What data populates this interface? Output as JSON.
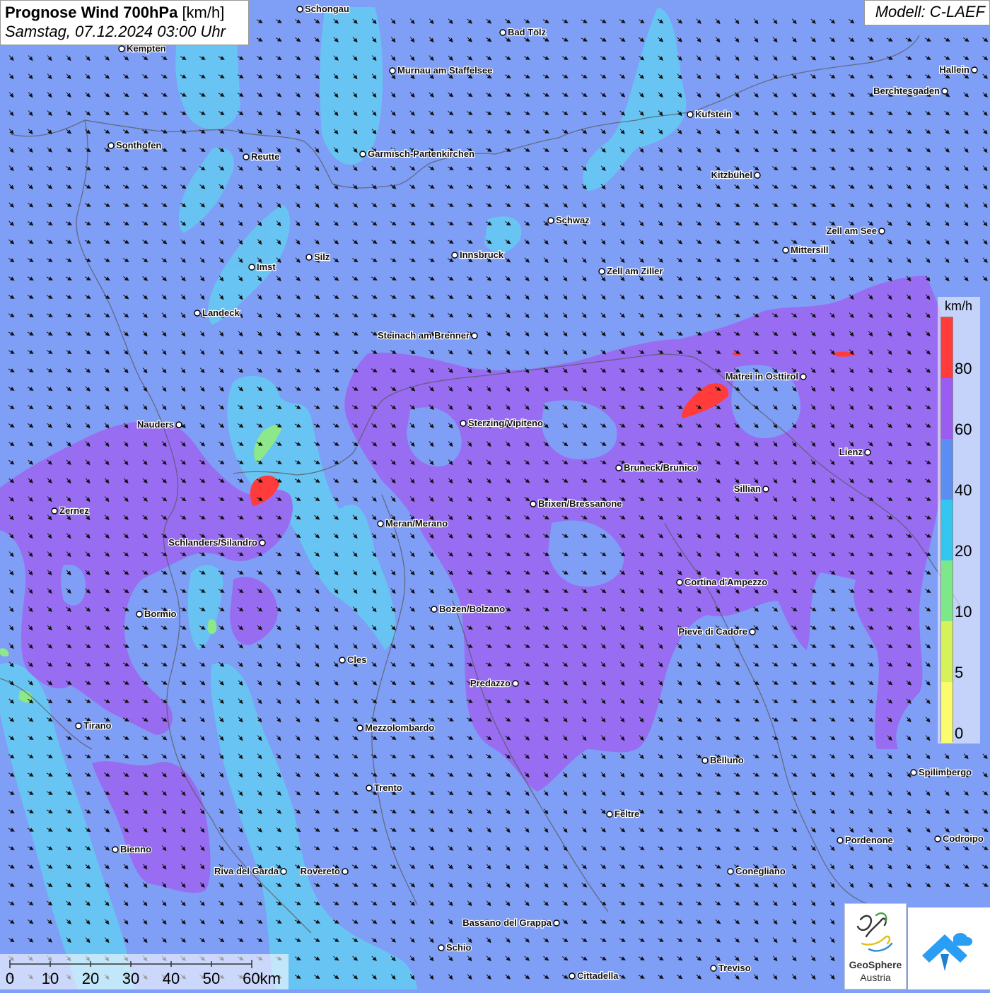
{
  "title": {
    "main": "Prognose Wind 700hPa",
    "unit": "[km/h]",
    "date": "Samstag, 07.12.2024 03:00 Uhr"
  },
  "model": "Modell: C-LAEF",
  "legend": {
    "unit": "km/h",
    "labels": [
      "80",
      "60",
      "40",
      "20",
      "10",
      "5",
      "0"
    ],
    "colors": [
      "#ff3b3b",
      "#9b5cf2",
      "#5b8ef2",
      "#33c6f0",
      "#7ce88a",
      "#d6f25a",
      "#fbfb6e"
    ]
  },
  "scale": {
    "labels": [
      "0",
      "10",
      "20",
      "30",
      "40",
      "50",
      "60km"
    ]
  },
  "logo": {
    "name": "GeoSphere",
    "country": "Austria"
  },
  "cities": [
    {
      "name": "Schongau",
      "x": 0
    },
    {
      "name": "Bad Tölz"
    },
    {
      "name": "Kempten"
    },
    {
      "name": "Murnau am Staffelsee"
    },
    {
      "name": "Hallein"
    },
    {
      "name": "Berchtesgaden"
    },
    {
      "name": "Kufstein"
    },
    {
      "name": "Sonthofen"
    },
    {
      "name": "Reutte"
    },
    {
      "name": "Garmisch-Partenkirchen"
    },
    {
      "name": "Kitzbühel"
    },
    {
      "name": "Schwaz"
    },
    {
      "name": "Zell am See"
    },
    {
      "name": "Mittersill"
    },
    {
      "name": "Innsbruck"
    },
    {
      "name": "Silz"
    },
    {
      "name": "Imst"
    },
    {
      "name": "Zell am Ziller"
    },
    {
      "name": "Landeck"
    },
    {
      "name": "Steinach am Brenner"
    },
    {
      "name": "Matrei in Osttirol"
    },
    {
      "name": "Nauders"
    },
    {
      "name": "Sterzing/Vipiteno"
    },
    {
      "name": "Lienz"
    },
    {
      "name": "Bruneck/Brunico"
    },
    {
      "name": "Sillian"
    },
    {
      "name": "Zernez"
    },
    {
      "name": "Brixen/Bressanone"
    },
    {
      "name": "Meran/Merano"
    },
    {
      "name": "Schlanders/Silandro"
    },
    {
      "name": "Cortina d'Ampezzo"
    },
    {
      "name": "Bozen/Bolzano"
    },
    {
      "name": "Bormio"
    },
    {
      "name": "Pieve di Cadore"
    },
    {
      "name": "Cles"
    },
    {
      "name": "Predazzo"
    },
    {
      "name": "Tirano"
    },
    {
      "name": "Mezzolombardo"
    },
    {
      "name": "Belluno"
    },
    {
      "name": "Spilimbergo"
    },
    {
      "name": "Trento"
    },
    {
      "name": "Feltre"
    },
    {
      "name": "Pordenone"
    },
    {
      "name": "Codroipo"
    },
    {
      "name": "Bienno"
    },
    {
      "name": "Riva del Garda"
    },
    {
      "name": "Rovereto"
    },
    {
      "name": "Conegliano"
    },
    {
      "name": "Bassano del Grappa"
    },
    {
      "name": "Schio"
    },
    {
      "name": "Treviso"
    },
    {
      "name": "Cittadella"
    }
  ]
}
